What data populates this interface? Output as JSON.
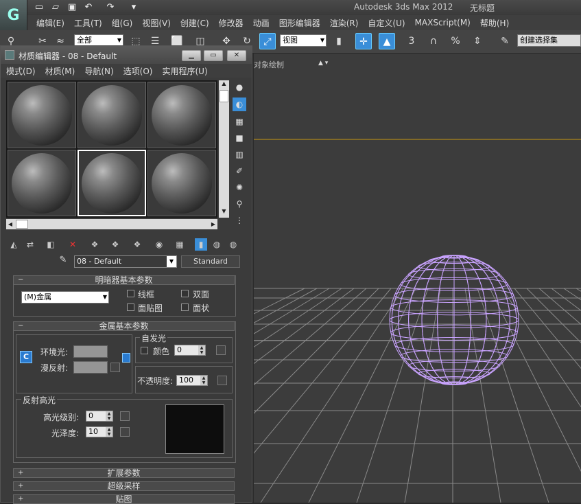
{
  "app": {
    "title": "Autodesk 3ds Max  2012",
    "doc": "无标题",
    "logo": "G"
  },
  "menubar": [
    "编辑(E)",
    "工具(T)",
    "组(G)",
    "视图(V)",
    "创建(C)",
    "修改器",
    "动画",
    "图形编辑器",
    "渲染(R)",
    "自定义(U)",
    "MAXScript(M)",
    "帮助(H)"
  ],
  "toolbar": {
    "filter_value": "全部",
    "refcoord_value": "视图",
    "selset_placeholder": "创建选择集",
    "snap_label": "3",
    "percent_label": "%"
  },
  "viewport": {
    "label": "对象绘制"
  },
  "mat_editor": {
    "title": "材质编辑器 - 08 - Default",
    "menus": [
      "模式(D)",
      "材质(M)",
      "导航(N)",
      "选项(O)",
      "实用程序(U)"
    ],
    "material_name": "08 - Default",
    "material_type": "Standard",
    "shader_rollout": {
      "title": "明暗器基本参数",
      "shader": "(M)金属",
      "wire": "线框",
      "two_sided": "双面",
      "face_map": "面贴图",
      "faceted": "面状"
    },
    "metal_rollout": {
      "title": "金属基本参数",
      "ambient": "环境光:",
      "diffuse": "漫反射:",
      "self_illum_group": "自发光",
      "color_label": "颜色",
      "self_illum_value": "0",
      "opacity_label": "不透明度:",
      "opacity_value": "100",
      "spec_group": "反射高光",
      "spec_level_label": "高光级别:",
      "spec_level_value": "0",
      "gloss_label": "光泽度:",
      "gloss_value": "10",
      "lock_label": "C"
    },
    "rollouts_collapsed": [
      "扩展参数",
      "超级采样",
      "贴图"
    ]
  }
}
